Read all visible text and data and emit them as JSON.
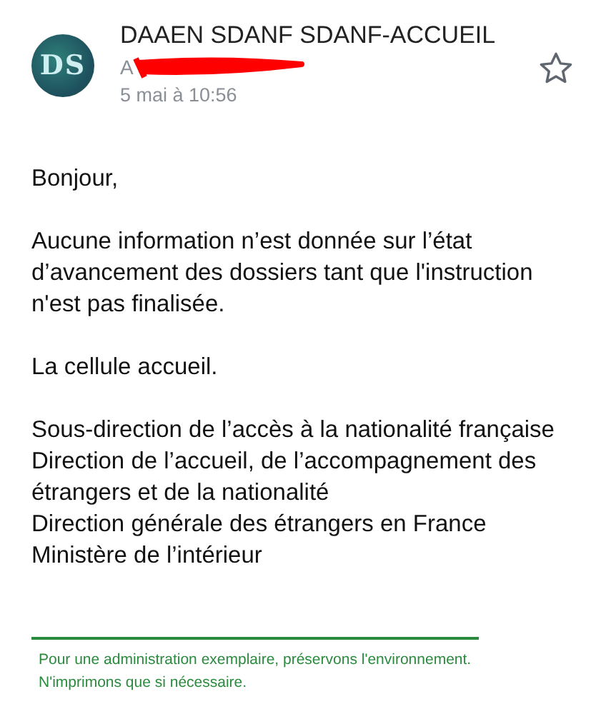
{
  "header": {
    "avatar_text": "DS",
    "sender": "DAAEN SDANF SDANF-ACCUEIL",
    "recipient": "A",
    "date": "5 mai à 10:56",
    "starred": false
  },
  "body": [
    {
      "lines": [
        "Bonjour,"
      ]
    },
    {
      "lines": [
        "Aucune information n’est donnée sur l’état d’avancement des dossiers tant que l'instruction n'est pas finalisée."
      ]
    },
    {
      "lines": [
        "La cellule accueil."
      ]
    },
    {
      "lines": [
        "Sous-direction de l’accès à la nationalité française",
        "Direction de l’accueil, de l’accompagnement des étrangers et de la nationalité",
        "Direction générale des étrangers en France",
        "Ministère de l’intérieur"
      ]
    }
  ],
  "footer": [
    "Pour une administration exemplaire, préservons l'environnement.",
    "N'imprimons que si nécessaire."
  ]
}
